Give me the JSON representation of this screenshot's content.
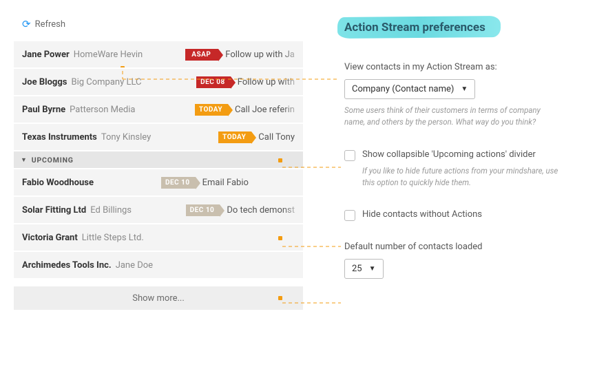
{
  "refresh_label": "Refresh",
  "items": [
    {
      "name": "Jane Power",
      "company": "HomeWare Hevin",
      "badge": "ASAP",
      "badge_color": "red",
      "action": "Follow up with Ja"
    },
    {
      "name": "Joe Bloggs",
      "company": "Big Company LLC",
      "badge": "DEC 08",
      "badge_color": "red",
      "action": "Follow up with"
    },
    {
      "name": "Paul Byrne",
      "company": "Patterson Media",
      "badge": "TODAY",
      "badge_color": "orange",
      "action": "Call Joe referin"
    },
    {
      "name": "Texas Instruments",
      "company": "Tony Kinsley",
      "badge": "TODAY",
      "badge_color": "orange",
      "action": "Call Tony"
    }
  ],
  "section_label": "UPCOMING",
  "upcoming": [
    {
      "name": "Fabio Woodhouse",
      "company": "",
      "badge": "DEC 10",
      "badge_color": "tan",
      "action": "Email Fabio"
    },
    {
      "name": "Solar Fitting Ltd",
      "company": "Ed Billings",
      "badge": "DEC 10",
      "badge_color": "tan",
      "action": "Do tech demonst"
    },
    {
      "name": "Victoria Grant",
      "company": "Little Steps Ltd.",
      "badge": "",
      "badge_color": "",
      "action": ""
    },
    {
      "name": "Archimedes Tools Inc.",
      "company": "Jane Doe",
      "badge": "",
      "badge_color": "",
      "action": ""
    }
  ],
  "show_more": "Show more...",
  "prefs": {
    "title": "Action Stream preferences",
    "view_as": {
      "label": "View contacts in my Action Stream as:",
      "value": "Company (Contact name)",
      "help": "Some users think of their customers in terms of company name, and others by the person. What way do you think?"
    },
    "upcoming_divider": {
      "label": "Show collapsible 'Upcoming actions' divider",
      "help": "If you like to hide future actions from your mindshare, use this option to quickly hide them."
    },
    "hide_no_actions": {
      "label": "Hide contacts without Actions"
    },
    "default_count": {
      "label": "Default number of contacts loaded",
      "value": "25"
    }
  }
}
